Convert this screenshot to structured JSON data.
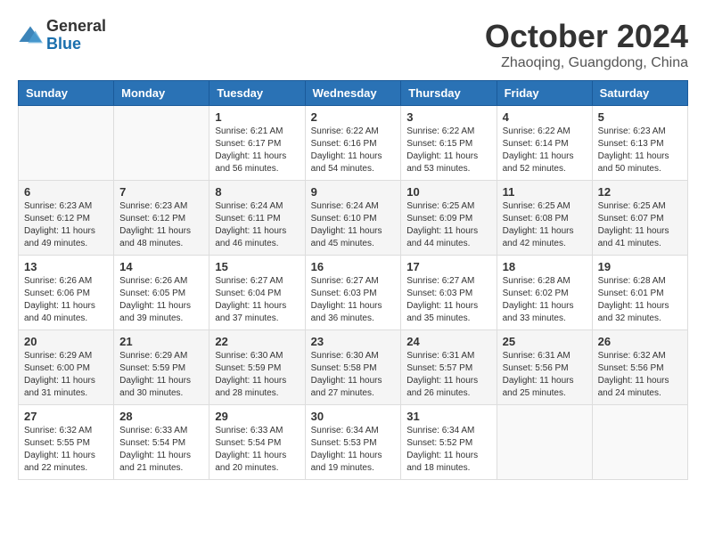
{
  "header": {
    "logo_general": "General",
    "logo_blue": "Blue",
    "month_title": "October 2024",
    "location": "Zhaoqing, Guangdong, China"
  },
  "calendar": {
    "days_of_week": [
      "Sunday",
      "Monday",
      "Tuesday",
      "Wednesday",
      "Thursday",
      "Friday",
      "Saturday"
    ],
    "weeks": [
      [
        {
          "day": "",
          "info": ""
        },
        {
          "day": "",
          "info": ""
        },
        {
          "day": "1",
          "info": "Sunrise: 6:21 AM\nSunset: 6:17 PM\nDaylight: 11 hours and 56 minutes."
        },
        {
          "day": "2",
          "info": "Sunrise: 6:22 AM\nSunset: 6:16 PM\nDaylight: 11 hours and 54 minutes."
        },
        {
          "day": "3",
          "info": "Sunrise: 6:22 AM\nSunset: 6:15 PM\nDaylight: 11 hours and 53 minutes."
        },
        {
          "day": "4",
          "info": "Sunrise: 6:22 AM\nSunset: 6:14 PM\nDaylight: 11 hours and 52 minutes."
        },
        {
          "day": "5",
          "info": "Sunrise: 6:23 AM\nSunset: 6:13 PM\nDaylight: 11 hours and 50 minutes."
        }
      ],
      [
        {
          "day": "6",
          "info": "Sunrise: 6:23 AM\nSunset: 6:12 PM\nDaylight: 11 hours and 49 minutes."
        },
        {
          "day": "7",
          "info": "Sunrise: 6:23 AM\nSunset: 6:12 PM\nDaylight: 11 hours and 48 minutes."
        },
        {
          "day": "8",
          "info": "Sunrise: 6:24 AM\nSunset: 6:11 PM\nDaylight: 11 hours and 46 minutes."
        },
        {
          "day": "9",
          "info": "Sunrise: 6:24 AM\nSunset: 6:10 PM\nDaylight: 11 hours and 45 minutes."
        },
        {
          "day": "10",
          "info": "Sunrise: 6:25 AM\nSunset: 6:09 PM\nDaylight: 11 hours and 44 minutes."
        },
        {
          "day": "11",
          "info": "Sunrise: 6:25 AM\nSunset: 6:08 PM\nDaylight: 11 hours and 42 minutes."
        },
        {
          "day": "12",
          "info": "Sunrise: 6:25 AM\nSunset: 6:07 PM\nDaylight: 11 hours and 41 minutes."
        }
      ],
      [
        {
          "day": "13",
          "info": "Sunrise: 6:26 AM\nSunset: 6:06 PM\nDaylight: 11 hours and 40 minutes."
        },
        {
          "day": "14",
          "info": "Sunrise: 6:26 AM\nSunset: 6:05 PM\nDaylight: 11 hours and 39 minutes."
        },
        {
          "day": "15",
          "info": "Sunrise: 6:27 AM\nSunset: 6:04 PM\nDaylight: 11 hours and 37 minutes."
        },
        {
          "day": "16",
          "info": "Sunrise: 6:27 AM\nSunset: 6:03 PM\nDaylight: 11 hours and 36 minutes."
        },
        {
          "day": "17",
          "info": "Sunrise: 6:27 AM\nSunset: 6:03 PM\nDaylight: 11 hours and 35 minutes."
        },
        {
          "day": "18",
          "info": "Sunrise: 6:28 AM\nSunset: 6:02 PM\nDaylight: 11 hours and 33 minutes."
        },
        {
          "day": "19",
          "info": "Sunrise: 6:28 AM\nSunset: 6:01 PM\nDaylight: 11 hours and 32 minutes."
        }
      ],
      [
        {
          "day": "20",
          "info": "Sunrise: 6:29 AM\nSunset: 6:00 PM\nDaylight: 11 hours and 31 minutes."
        },
        {
          "day": "21",
          "info": "Sunrise: 6:29 AM\nSunset: 5:59 PM\nDaylight: 11 hours and 30 minutes."
        },
        {
          "day": "22",
          "info": "Sunrise: 6:30 AM\nSunset: 5:59 PM\nDaylight: 11 hours and 28 minutes."
        },
        {
          "day": "23",
          "info": "Sunrise: 6:30 AM\nSunset: 5:58 PM\nDaylight: 11 hours and 27 minutes."
        },
        {
          "day": "24",
          "info": "Sunrise: 6:31 AM\nSunset: 5:57 PM\nDaylight: 11 hours and 26 minutes."
        },
        {
          "day": "25",
          "info": "Sunrise: 6:31 AM\nSunset: 5:56 PM\nDaylight: 11 hours and 25 minutes."
        },
        {
          "day": "26",
          "info": "Sunrise: 6:32 AM\nSunset: 5:56 PM\nDaylight: 11 hours and 24 minutes."
        }
      ],
      [
        {
          "day": "27",
          "info": "Sunrise: 6:32 AM\nSunset: 5:55 PM\nDaylight: 11 hours and 22 minutes."
        },
        {
          "day": "28",
          "info": "Sunrise: 6:33 AM\nSunset: 5:54 PM\nDaylight: 11 hours and 21 minutes."
        },
        {
          "day": "29",
          "info": "Sunrise: 6:33 AM\nSunset: 5:54 PM\nDaylight: 11 hours and 20 minutes."
        },
        {
          "day": "30",
          "info": "Sunrise: 6:34 AM\nSunset: 5:53 PM\nDaylight: 11 hours and 19 minutes."
        },
        {
          "day": "31",
          "info": "Sunrise: 6:34 AM\nSunset: 5:52 PM\nDaylight: 11 hours and 18 minutes."
        },
        {
          "day": "",
          "info": ""
        },
        {
          "day": "",
          "info": ""
        }
      ]
    ]
  }
}
